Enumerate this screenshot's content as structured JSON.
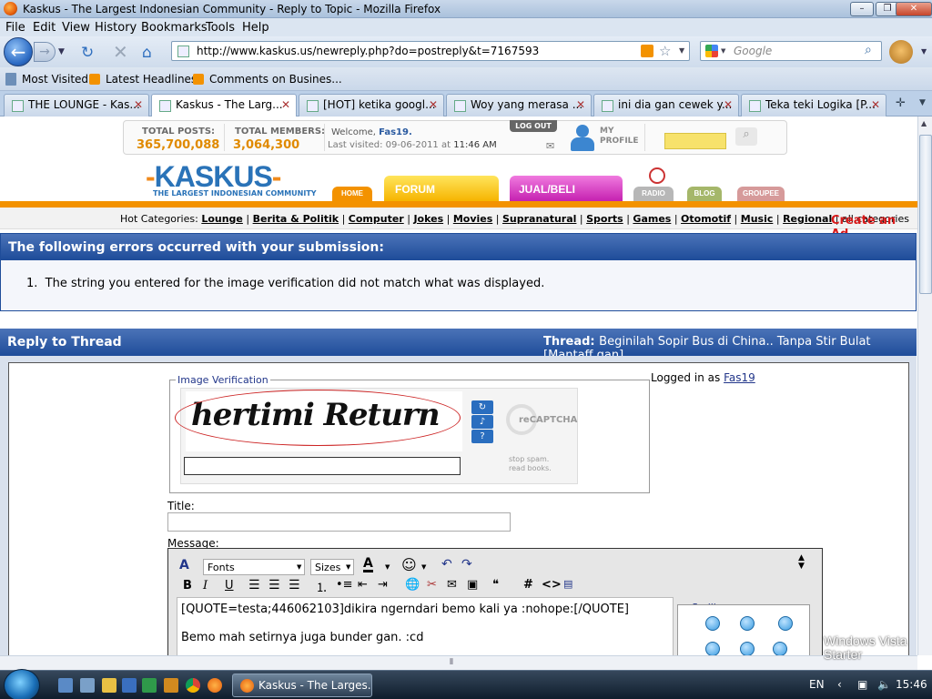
{
  "window": {
    "title": "Kaskus - The Largest Indonesian Community - Reply to Topic - Mozilla Firefox"
  },
  "menu": [
    "File",
    "Edit",
    "View",
    "History",
    "Bookmarks",
    "Tools",
    "Help"
  ],
  "nav": {
    "url": "http://www.kaskus.us/newreply.php?do=postreply&t=7167593",
    "search_placeholder": "Google"
  },
  "bookmarks": [
    "Most Visited",
    "Latest Headlines",
    "Comments on Busines..."
  ],
  "tabs": [
    "THE LOUNGE - Kas...",
    "Kaskus - The Larg...",
    "[HOT] ketika googl...",
    "Woy yang merasa ...",
    "ini dia gan cewek y...",
    "Teka teki Logika [P..."
  ],
  "header": {
    "total_posts_label": "TOTAL POSTS:",
    "total_posts": "365,700,088",
    "total_members_label": "TOTAL MEMBERS:",
    "total_members": "3,064,300",
    "welcome_prefix": "Welcome,",
    "username": "Fas19.",
    "last_visited_prefix": "Last visited:",
    "last_visited_date": "09-06-2011",
    "last_visited_at": "at",
    "last_visited_time": "11:46 AM",
    "logout": "LOG OUT",
    "my": "MY",
    "profile": "PROFILE"
  },
  "logo": {
    "text": "KASKUS",
    "tagline": "THE LARGEST INDONESIAN COMMUNITY"
  },
  "site_nav": [
    "HOME",
    "FORUM",
    "JUAL/BELI",
    "RADIO",
    "BLOG",
    "GROUPEE"
  ],
  "hot_categories": {
    "label": "Hot Categories:",
    "items": [
      "Lounge",
      "Berita & Politik",
      "Computer",
      "Jokes",
      "Movies",
      "Supranatural",
      "Sports",
      "Games",
      "Otomotif",
      "Music",
      "Regional"
    ],
    "all": "all categories"
  },
  "create_ad": "Create an Ad",
  "errors": {
    "title": "The following errors occurred with your submission:",
    "items": [
      "The string you entered for the image verification did not match what was displayed."
    ]
  },
  "reply": {
    "title": "Reply to Thread",
    "thread_label": "Thread:",
    "thread_name": "Beginilah Sopir Bus di China.. Tanpa Stir Bulat [Mantaff gan]",
    "logged_in_label": "Logged in as",
    "logged_in_user": "Fas19",
    "image_verification": "Image Verification",
    "captcha_word": "hertimi Return",
    "recaptcha_brand": "reCAPTCHA",
    "recaptcha_tagline1": "stop spam.",
    "recaptcha_tagline2": "read books.",
    "title_label": "Title:",
    "message_label": "Message:",
    "font_select": "Fonts",
    "size_select": "Sizes",
    "message_line1": "[QUOTE=testa;446062103]dikira ngerndari bemo kali ya :nohope:[/QUOTE]",
    "message_line2": "Bemo mah setirnya juga bunder gan. :cd",
    "smilies_label": "Smilies"
  },
  "taskbar": {
    "task": "Kaskus - The Larges...",
    "lang": "EN",
    "time": "15:46",
    "watermark1": "Windows Vista",
    "watermark2": "Starter"
  }
}
